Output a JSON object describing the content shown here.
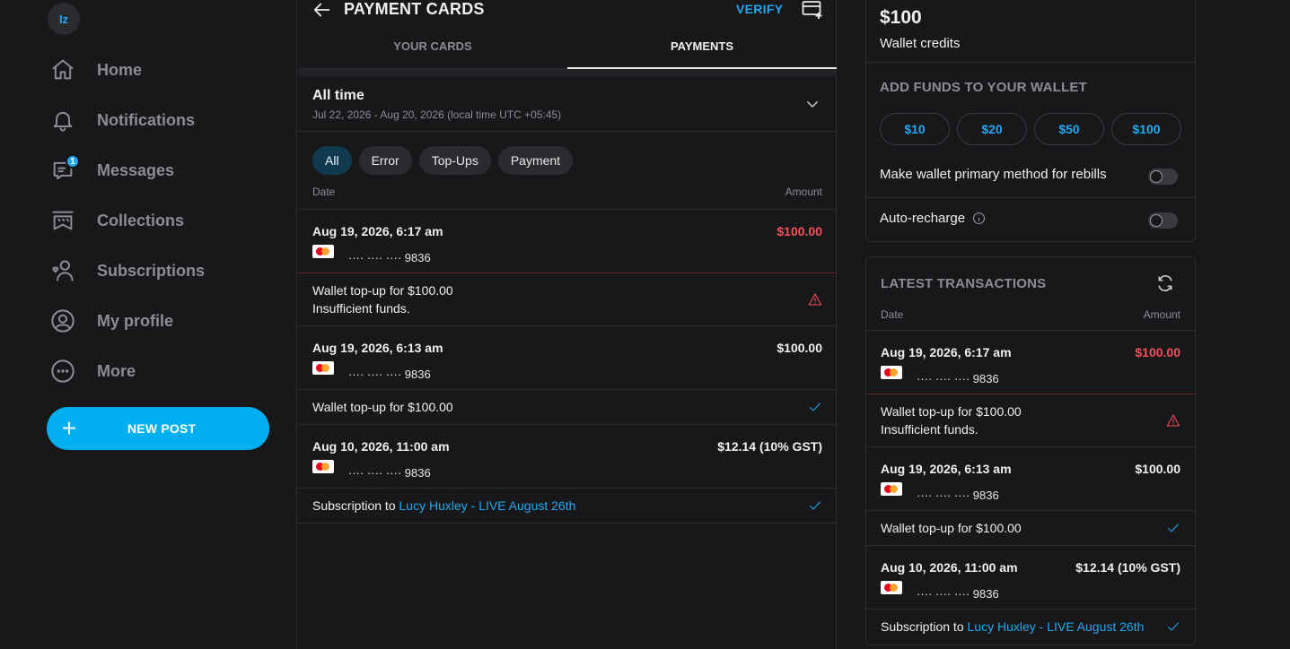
{
  "sidebar": {
    "avatar_initials": "Iz",
    "items": [
      {
        "label": "Home",
        "icon": "home-icon"
      },
      {
        "label": "Notifications",
        "icon": "bell-icon"
      },
      {
        "label": "Messages",
        "icon": "message-icon",
        "badge": "1"
      },
      {
        "label": "Collections",
        "icon": "collections-icon"
      },
      {
        "label": "Subscriptions",
        "icon": "subscriptions-icon"
      },
      {
        "label": "My profile",
        "icon": "profile-icon"
      },
      {
        "label": "More",
        "icon": "more-icon"
      }
    ],
    "new_post_label": "NEW POST"
  },
  "header": {
    "title": "PAYMENT CARDS",
    "verify_label": "VERIFY"
  },
  "tabs": [
    {
      "label": "YOUR CARDS",
      "active": false
    },
    {
      "label": "PAYMENTS",
      "active": true
    }
  ],
  "period": {
    "title": "All time",
    "range": "Jul 22, 2026 - Aug 20, 2026 (local time UTC +05:45)"
  },
  "filters": [
    "All",
    "Error",
    "Top-Ups",
    "Payment"
  ],
  "columns": {
    "date": "Date",
    "amount": "Amount"
  },
  "transactions": [
    {
      "date": "Aug 19, 2026, 6:17 am",
      "amount": "$100.00",
      "error": true,
      "card": "···· ···· ···· 9836",
      "line1": "Wallet top-up for $100.00",
      "line2": "Insufficient funds.",
      "status": "warning"
    },
    {
      "date": "Aug 19, 2026, 6:13 am",
      "amount": "$100.00",
      "error": false,
      "card": "···· ···· ···· 9836",
      "line1": "Wallet top-up for $100.00",
      "status": "success"
    },
    {
      "date": "Aug 10, 2026, 11:00 am",
      "amount": "$12.14 (10% GST)",
      "error": false,
      "card": "···· ···· ···· 9836",
      "prefix": "Subscription to ",
      "link": "Lucy Huxley - LIVE August 26th",
      "status": "success"
    }
  ],
  "wallet": {
    "amount": "$100",
    "label": "Wallet credits",
    "add_funds_title": "ADD FUNDS TO YOUR WALLET",
    "fund_options": [
      "$10",
      "$20",
      "$50",
      "$100"
    ],
    "primary_label": "Make wallet primary method for rebills",
    "auto_recharge_label": "Auto-recharge"
  },
  "latest": {
    "title": "LATEST TRANSACTIONS"
  },
  "colors": {
    "accent": "#00aff0",
    "error": "#f4505a",
    "background": "#18181b"
  }
}
